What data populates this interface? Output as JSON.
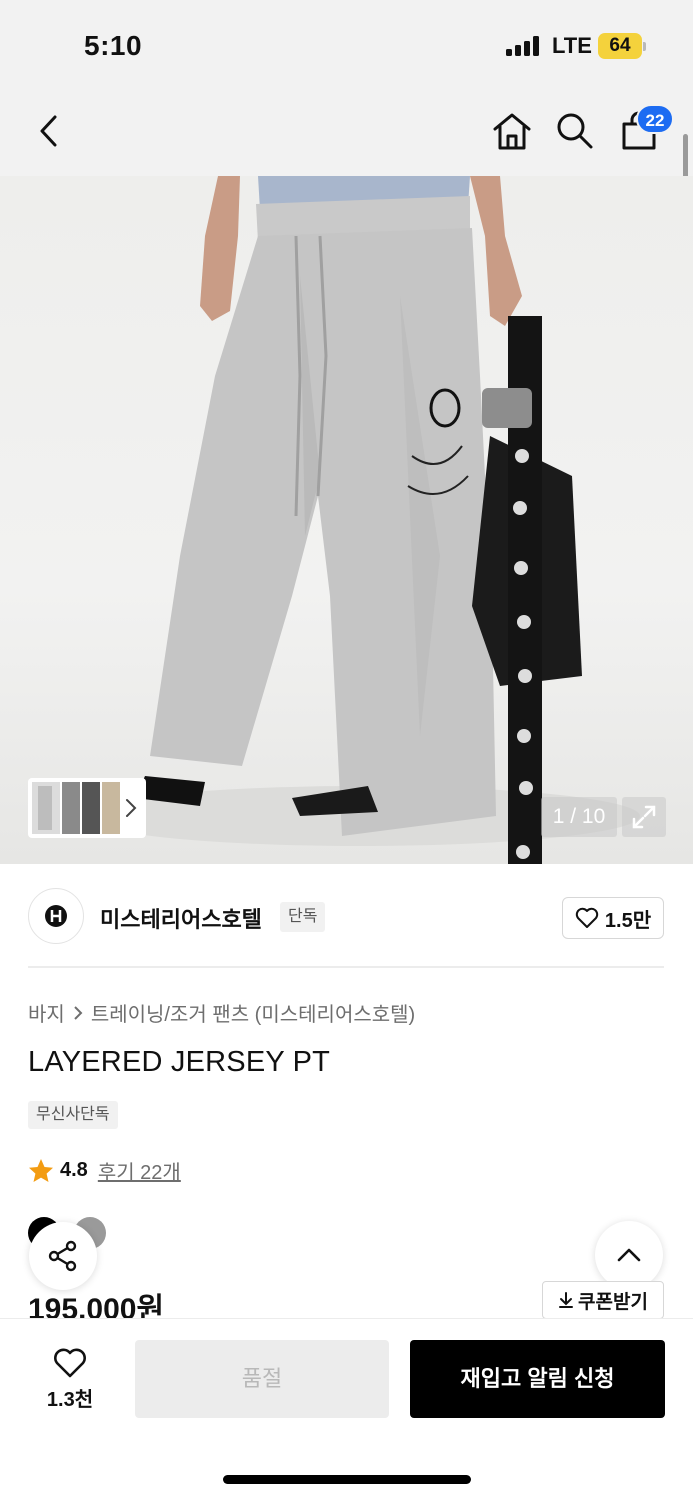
{
  "status_bar": {
    "time": "5:10",
    "network": "LTE",
    "battery": "64"
  },
  "nav": {
    "cart_count": "22"
  },
  "gallery": {
    "counter": "1 / 10"
  },
  "brand": {
    "name": "미스테리어스호텔",
    "badge": "단독",
    "likes": "1.5만"
  },
  "breadcrumb": {
    "category": "바지",
    "subcategory": "트레이닝/조거 팬츠 (미스테리어스호텔)"
  },
  "product": {
    "title": "LAYERED JERSEY PT",
    "tag": "무신사단독",
    "rating": "4.8",
    "reviews": "후기 22개",
    "price": "195,000원",
    "coupon_label": "쿠폰받기",
    "colors": [
      "#000000",
      "#9a9a9a"
    ]
  },
  "bottom_bar": {
    "wish_count": "1.3천",
    "soldout_label": "품절",
    "restock_label": "재입고 알림 신청"
  }
}
